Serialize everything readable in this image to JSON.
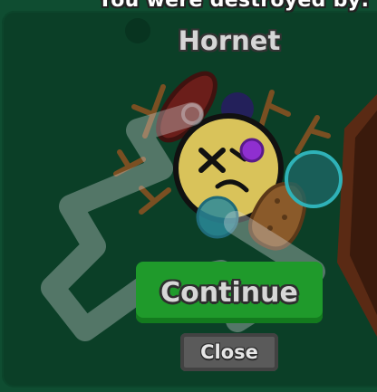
{
  "death_screen": {
    "title": "You were destroyed by:",
    "killer": "Hornet"
  },
  "buttons": {
    "continue_label": "Continue",
    "close_label": "Close"
  },
  "colors": {
    "background": "#0b3f27",
    "continue_button": "#1f9a2b",
    "close_button": "#5a5a5a",
    "player_face": "#d9c35a"
  },
  "icons": {
    "player": "dead-flower-icon",
    "petals": [
      "antennae-icon",
      "peas-icon",
      "bubble-icon"
    ]
  }
}
